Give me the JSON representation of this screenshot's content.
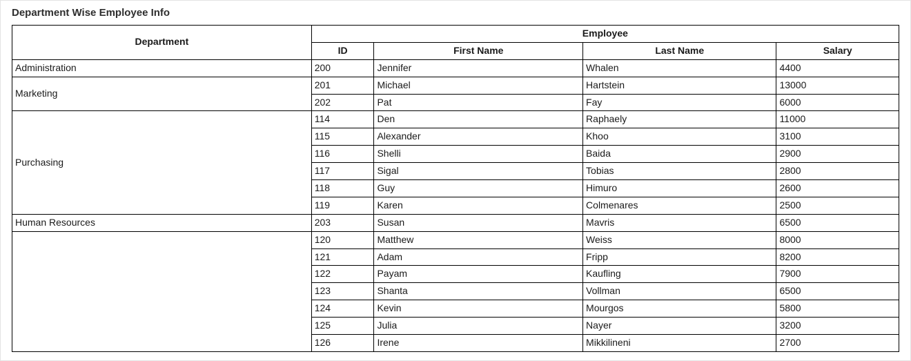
{
  "title": "Department Wise Employee Info",
  "headers": {
    "department": "Department",
    "employee": "Employee",
    "id": "ID",
    "first_name": "First Name",
    "last_name": "Last Name",
    "salary": "Salary"
  },
  "departments": [
    {
      "name": "Administration",
      "employees": [
        {
          "id": "200",
          "first_name": "Jennifer",
          "last_name": "Whalen",
          "salary": "4400"
        }
      ]
    },
    {
      "name": "Marketing",
      "employees": [
        {
          "id": "201",
          "first_name": "Michael",
          "last_name": "Hartstein",
          "salary": "13000"
        },
        {
          "id": "202",
          "first_name": "Pat",
          "last_name": "Fay",
          "salary": "6000"
        }
      ]
    },
    {
      "name": "Purchasing",
      "employees": [
        {
          "id": "114",
          "first_name": "Den",
          "last_name": "Raphaely",
          "salary": "11000"
        },
        {
          "id": "115",
          "first_name": "Alexander",
          "last_name": "Khoo",
          "salary": "3100"
        },
        {
          "id": "116",
          "first_name": "Shelli",
          "last_name": "Baida",
          "salary": "2900"
        },
        {
          "id": "117",
          "first_name": "Sigal",
          "last_name": "Tobias",
          "salary": "2800"
        },
        {
          "id": "118",
          "first_name": "Guy",
          "last_name": "Himuro",
          "salary": "2600"
        },
        {
          "id": "119",
          "first_name": "Karen",
          "last_name": "Colmenares",
          "salary": "2500"
        }
      ]
    },
    {
      "name": "Human Resources",
      "employees": [
        {
          "id": "203",
          "first_name": "Susan",
          "last_name": "Mavris",
          "salary": "6500"
        }
      ]
    },
    {
      "name": "",
      "employees": [
        {
          "id": "120",
          "first_name": "Matthew",
          "last_name": "Weiss",
          "salary": "8000"
        },
        {
          "id": "121",
          "first_name": "Adam",
          "last_name": "Fripp",
          "salary": "8200"
        },
        {
          "id": "122",
          "first_name": "Payam",
          "last_name": "Kaufling",
          "salary": "7900"
        },
        {
          "id": "123",
          "first_name": "Shanta",
          "last_name": "Vollman",
          "salary": "6500"
        },
        {
          "id": "124",
          "first_name": "Kevin",
          "last_name": "Mourgos",
          "salary": "5800"
        },
        {
          "id": "125",
          "first_name": "Julia",
          "last_name": "Nayer",
          "salary": "3200"
        },
        {
          "id": "126",
          "first_name": "Irene",
          "last_name": "Mikkilineni",
          "salary": "2700"
        }
      ]
    }
  ]
}
